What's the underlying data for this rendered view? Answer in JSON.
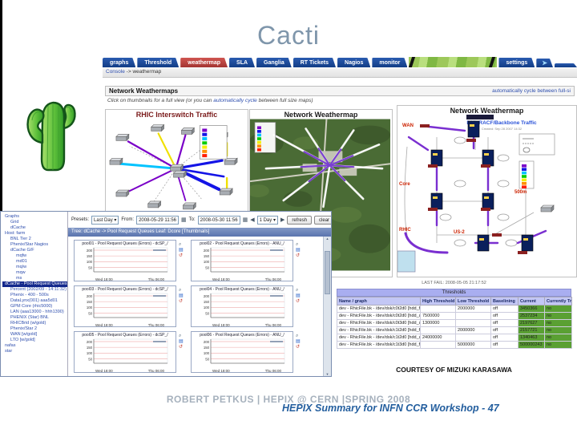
{
  "slide": {
    "title": "Cacti",
    "footer_line1": "ROBERT PETKUS | HEPIX @ CERN |SPRING 2008",
    "footer_line2": "HEPIX Summary for INFN CCR Workshop - 47"
  },
  "colors": {
    "tab_blue": "#123d86",
    "tab_active_red": "#b94440",
    "threshold_green": "#5aa033",
    "threshold_lavender": "#a9aef0",
    "link_blue": "#2f4fae",
    "title_gray_blue": "#7f96ab",
    "footer_blue": "#235e9e"
  },
  "icons": {
    "calendar": "▦",
    "prev": "◀",
    "next": "▶",
    "zoom": "⌕",
    "csv": "▤",
    "source": "↺",
    "scroll_up": "▲",
    "scroll_down": "▼",
    "cacti_tab": "➤"
  },
  "cacti": {
    "tabs": [
      {
        "label": "graphs"
      },
      {
        "label": "Threshold"
      },
      {
        "label": "weathermap",
        "active": true
      },
      {
        "label": "SLA"
      },
      {
        "label": "Ganglia"
      },
      {
        "label": "RT Tickets"
      },
      {
        "label": "Nagios"
      },
      {
        "label": "monitor"
      }
    ],
    "settings_tab": "settings",
    "breadcrumb_console": "Console",
    "breadcrumb_path": "-> weathermap",
    "weathermaps": {
      "header": "Network Weathermaps",
      "header_link": "automatically cycle between full-si",
      "subtext_pre": "Click on thumbnails for a full view (or you can ",
      "subtext_link": "automatically cycle",
      "subtext_post": " between full size maps)",
      "legend_colors": [
        "#7a00c8",
        "#1414e6",
        "#00c3ff",
        "#00cc00",
        "#f4ef00",
        "#ff9000",
        "#ff1e00"
      ],
      "maps": [
        {
          "title": "RHIC Interswitch Traffic"
        },
        {
          "title": "Network Weathermap"
        },
        {
          "title": "Network Weathermap",
          "subtitle": "BNL RACF/Backbone Traffic",
          "timestamp": "Created: Sep 28 2007 14:32",
          "labels": {
            "wan": "WAN",
            "core": "Core",
            "rhic": "RHIC",
            "us2": "US-2",
            "rate": "500m"
          }
        }
      ]
    },
    "thresholds": {
      "last_fail": "LAST FAIL: 2008-05-05 21:17:52",
      "bar_title": "Thresholds",
      "columns": [
        "Name / graph",
        "High Threshold",
        "Low Threshold",
        "Baselining",
        "Current",
        "Currently Triggered"
      ],
      "rows": [
        {
          "name": "dev - RhicFile.bk - /dev/dsk/c0t2d0 [hdd_free]",
          "high": "",
          "low": "2000000",
          "baselining": "off",
          "current": "3450366",
          "triggered": "no"
        },
        {
          "name": "dev - RhicFile.bk - /dev/dsk/c0t2d0 [hdd_used]",
          "high": "7500000",
          "low": "",
          "baselining": "off",
          "current": "2537234",
          "triggered": "no"
        },
        {
          "name": "dev - RhicFile.bk - /dev/dsk/c0t3d0 [hdd_used]",
          "high": "1300000",
          "low": "",
          "baselining": "off",
          "current": "2197627",
          "triggered": "no"
        },
        {
          "name": "dev - RhicFile.bk - /dev/dsk/c1t2d0 [hdd_free]",
          "high": "",
          "low": "2000000",
          "baselining": "off",
          "current": "2157721",
          "triggered": "no"
        },
        {
          "name": "dev - RhicFile.bk - /dev/dsk/c1t2d0 [hdd_used]",
          "high": "24000000",
          "low": "",
          "baselining": "off",
          "current": "1340463",
          "triggered": "no"
        },
        {
          "name": "dev - RhicFile.bk - /dev/dsk/c1t3d0 [hdd_free]",
          "high": "",
          "low": "5000000",
          "baselining": "off",
          "current": "500000243",
          "triggered": "no"
        }
      ],
      "courtesy": "COURTESY OF MIZUKI KARASAWA"
    }
  },
  "graph_window": {
    "tree_items": [
      {
        "t": "Graphs",
        "d": 0
      },
      {
        "t": "Grid",
        "d": 1
      },
      {
        "t": "dCache",
        "d": 1
      },
      {
        "t": "Host: farm",
        "d": 0
      },
      {
        "t": "BNL Tier 2",
        "d": 1
      },
      {
        "t": "Phenix/Star Nagios",
        "d": 1
      },
      {
        "t": "dCache G/F",
        "d": 1
      },
      {
        "t": "mqfw",
        "d": 2
      },
      {
        "t": "md01",
        "d": 2
      },
      {
        "t": "mq/w",
        "d": 2
      },
      {
        "t": "mqw",
        "d": 2
      },
      {
        "t": "ms",
        "d": 2
      },
      {
        "t": "dCache - Pool Request Queues",
        "d": 0,
        "sel": true
      },
      {
        "t": "Percent (2002/09 - 14:11:32)",
        "d": 1
      },
      {
        "t": "Phenix - 400 - 500s",
        "d": 1
      },
      {
        "t": "DataLynx(001) aaa5d01",
        "d": 1
      },
      {
        "t": "GPM Core (rhic5000)",
        "d": 1
      },
      {
        "t": "LAN (aaa13000 - hhh1390)",
        "d": 1
      },
      {
        "t": "PHENIX (Star) BNL",
        "d": 1
      },
      {
        "t": "RHICBrid (w/gold)",
        "d": 1
      },
      {
        "t": "Phenix/Star 2",
        "d": 1
      },
      {
        "t": "WAN [w/gold]",
        "d": 1
      },
      {
        "t": "LTO [w/gold]",
        "d": 1
      },
      {
        "t": "nafas",
        "d": 0
      },
      {
        "t": "star",
        "d": 0
      }
    ],
    "toolbar": {
      "presets_label": "Presets:",
      "presets_value": "Last Day",
      "from_label": "From:",
      "from_value": "2008-05-29 11:56",
      "to_label": "To:",
      "to_value": "2008-05-30 11:56",
      "range_value": "1 Day",
      "refresh_label": "refresh",
      "clear_label": "clear"
    },
    "title_bar": "Tree: dCache -> Pool Request Queues Leaf: Dcore [Thumbnails]",
    "yticks": [
      "200",
      "150",
      "100",
      "50"
    ],
    "xlabels": [
      "Wed 18:00",
      "Thu 06:00"
    ],
    "graphs": [
      {
        "title": "pool01 - Pool Request Queues (Errors) - dcSP_/"
      },
      {
        "title": "pool02 - Pool Request Queues (Errors) - ANU_/"
      },
      {
        "title": "pool03 - Pool Request Queues (Errors) - dcSP_/"
      },
      {
        "title": "pool04 - Pool Request Queues (Errors) - ANU_/"
      },
      {
        "title": "pool05 - Pool Request Queues (Errors) - dcSP_/"
      },
      {
        "title": "pool06 - Pool Request Queues (Errors) - ANU_/"
      }
    ]
  }
}
